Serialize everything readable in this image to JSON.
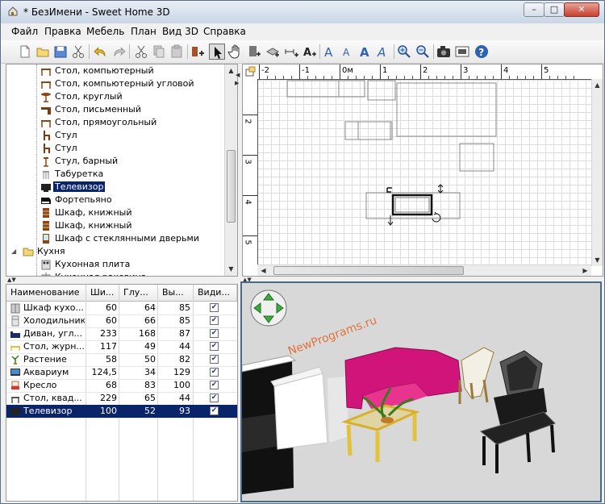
{
  "window": {
    "title": "* БезИмени - Sweet Home 3D",
    "min_label": "–",
    "max_label": "□",
    "close_label": "✕"
  },
  "menu": [
    "Файл",
    "Правка",
    "Мебель",
    "План",
    "Вид 3D",
    "Справка"
  ],
  "toolbar": {
    "icons": [
      "new-icon",
      "open-icon",
      "save-icon",
      "cut-icon",
      "undo-icon",
      "redo-icon",
      "cut-icon",
      "copy-icon",
      "paste-icon",
      "add-furniture-icon",
      "select-icon",
      "pan-icon",
      "create-walls-icon",
      "create-rooms-icon",
      "create-dimensions-icon",
      "add-text-icon",
      "text-style-a-icon",
      "text-style-a-icon",
      "text-bold-icon",
      "text-italic-icon",
      "zoom-in-icon",
      "zoom-out-icon",
      "camera-icon",
      "video-icon",
      "help-icon"
    ]
  },
  "catalog": {
    "items": [
      {
        "label": "Стол, компьютерный",
        "icon": "table-icon",
        "indent": 2
      },
      {
        "label": "Стол, компьютерный угловой",
        "icon": "table-icon",
        "indent": 2
      },
      {
        "label": "Стол, круглый",
        "icon": "round-table-icon",
        "indent": 2
      },
      {
        "label": "Стол, письменный",
        "icon": "desk-icon",
        "indent": 2
      },
      {
        "label": "Стол, прямоугольный",
        "icon": "table-icon",
        "indent": 2
      },
      {
        "label": "Стул",
        "icon": "chair-icon",
        "indent": 2
      },
      {
        "label": "Стул",
        "icon": "chair-icon",
        "indent": 2
      },
      {
        "label": "Стул, барный",
        "icon": "bar-stool-icon",
        "indent": 2
      },
      {
        "label": "Табуретка",
        "icon": "stool-icon",
        "indent": 2
      },
      {
        "label": "Телевизор",
        "icon": "tv-icon",
        "indent": 2,
        "selected": true
      },
      {
        "label": "Фортепьяно",
        "icon": "piano-icon",
        "indent": 2
      },
      {
        "label": "Шкаф, книжный",
        "icon": "bookcase-icon",
        "indent": 2
      },
      {
        "label": "Шкаф, книжный",
        "icon": "bookcase-icon",
        "indent": 2
      },
      {
        "label": "Шкаф с стеклянными дверьми",
        "icon": "cabinet-icon",
        "indent": 2
      },
      {
        "label": "Кухня",
        "icon": "folder-icon",
        "indent": 1
      },
      {
        "label": "Кухонная плита",
        "icon": "stove-icon",
        "indent": 2
      },
      {
        "label": "Кухонная раковина",
        "icon": "sink-icon",
        "indent": 2
      }
    ]
  },
  "furniture": {
    "columns": [
      "Наименование",
      "Ши...",
      "Глу...",
      "Вы...",
      "Види..."
    ],
    "rows": [
      {
        "icon": "kitchen-cabinet-icon",
        "name": "Шкаф кухо...",
        "w": "60",
        "d": "64",
        "h": "85",
        "visible": true
      },
      {
        "icon": "fridge-icon",
        "name": "Холодильник",
        "w": "60",
        "d": "66",
        "h": "85",
        "visible": true
      },
      {
        "icon": "sofa-icon",
        "name": "Диван, угл...",
        "w": "233",
        "d": "168",
        "h": "87",
        "visible": true
      },
      {
        "icon": "coffee-table-icon",
        "name": "Стол, журн...",
        "w": "117",
        "d": "49",
        "h": "44",
        "visible": true
      },
      {
        "icon": "plant-icon",
        "name": "Растение",
        "w": "58",
        "d": "50",
        "h": "82",
        "visible": true
      },
      {
        "icon": "aquarium-icon",
        "name": "Аквариум",
        "w": "124,5",
        "d": "34",
        "h": "129",
        "visible": true
      },
      {
        "icon": "armchair-icon",
        "name": "Кресло",
        "w": "68",
        "d": "83",
        "h": "100",
        "visible": true
      },
      {
        "icon": "square-table-icon",
        "name": "Стол, квад...",
        "w": "229",
        "d": "65",
        "h": "44",
        "visible": true
      },
      {
        "icon": "tv-icon",
        "name": "Телевизор",
        "w": "100",
        "d": "52",
        "h": "93",
        "visible": true,
        "selected": true
      }
    ]
  },
  "plan": {
    "ruler_x": [
      "-2",
      "-1",
      "0м",
      "1",
      "2",
      "3",
      "4",
      "5"
    ],
    "ruler_y": [
      "2",
      "3",
      "4",
      "5"
    ]
  },
  "view3d": {
    "watermark": "NewPrograms.ru"
  }
}
